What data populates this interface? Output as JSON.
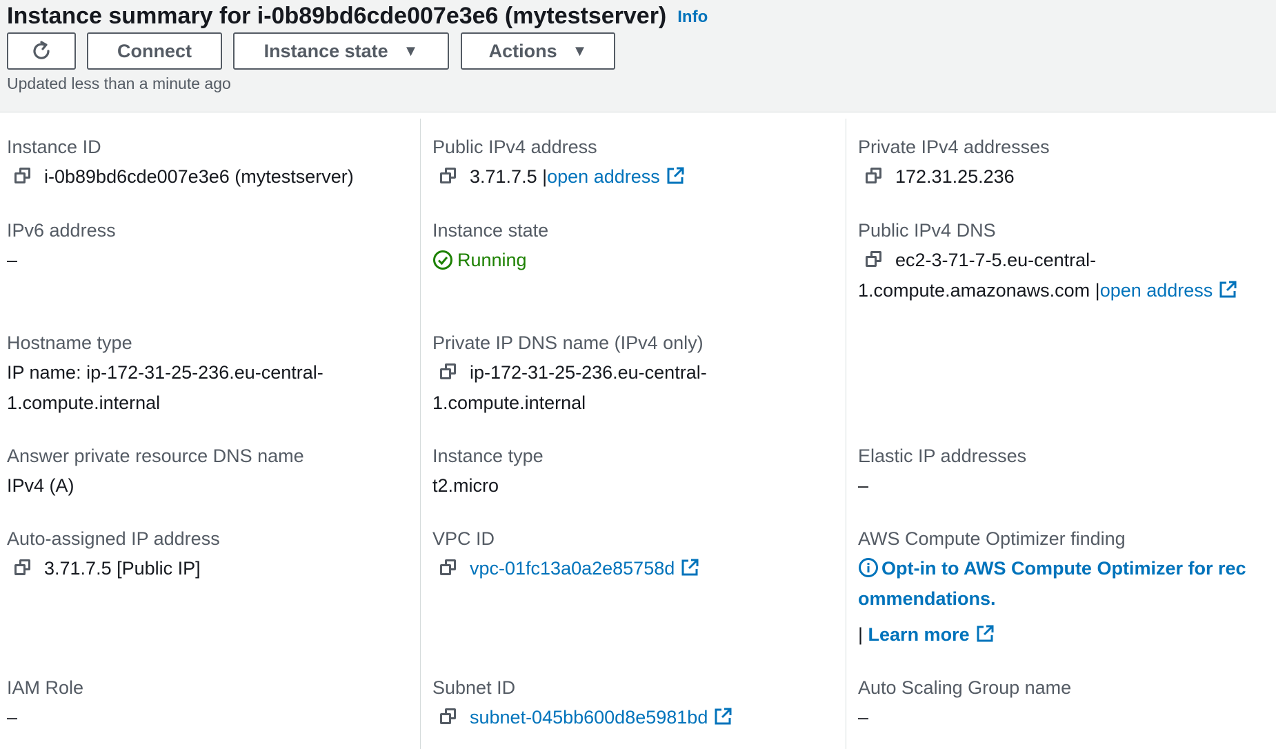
{
  "header": {
    "title": "Instance summary for i-0b89bd6cde007e3e6 (mytestserver)",
    "info_label": "Info",
    "buttons": {
      "refresh_icon": "refresh-icon",
      "connect": "Connect",
      "instance_state": "Instance state",
      "actions": "Actions"
    },
    "updated": "Updated less than a minute ago"
  },
  "details": {
    "instance_id": {
      "label": "Instance ID",
      "value": "i-0b89bd6cde007e3e6 (mytestserver)"
    },
    "public_ipv4": {
      "label": "Public IPv4 address",
      "value": "3.71.7.5",
      "sep": "|",
      "link": "open address"
    },
    "private_ipv4": {
      "label": "Private IPv4 addresses",
      "value": "172.31.25.236"
    },
    "ipv6": {
      "label": "IPv6 address",
      "value": "–"
    },
    "instance_state": {
      "label": "Instance state",
      "value": "Running"
    },
    "public_dns": {
      "label": "Public IPv4 DNS",
      "value_line1": "ec2-3-71-7-5.eu-central-",
      "value_line2": "1.compute.amazonaws.com",
      "sep": "|",
      "link": "open address"
    },
    "hostname_type": {
      "label": "Hostname type",
      "value_line1": "IP name: ip-172-31-25-236.eu-central-",
      "value_line2": "1.compute.internal"
    },
    "private_dns": {
      "label": "Private IP DNS name (IPv4 only)",
      "value_line1": "ip-172-31-25-236.eu-central-",
      "value_line2": "1.compute.internal"
    },
    "answer_dns": {
      "label": "Answer private resource DNS name",
      "value": "IPv4 (A)"
    },
    "instance_type": {
      "label": "Instance type",
      "value": "t2.micro"
    },
    "elastic_ip": {
      "label": "Elastic IP addresses",
      "value": "–"
    },
    "auto_ip": {
      "label": "Auto-assigned IP address",
      "value": "3.71.7.5 [Public IP]"
    },
    "vpc_id": {
      "label": "VPC ID",
      "value": "vpc-01fc13a0a2e85758d"
    },
    "optimizer": {
      "label": "AWS Compute Optimizer finding",
      "line1": "Opt-in to AWS Compute Optimizer for rec",
      "line2": "ommendations.",
      "sep": "|",
      "learn_more": "Learn more"
    },
    "iam_role": {
      "label": "IAM Role",
      "value": "–"
    },
    "subnet_id": {
      "label": "Subnet ID",
      "value": "subnet-045bb600d8e5981bd"
    },
    "asg_name": {
      "label": "Auto Scaling Group name",
      "value": "–"
    }
  },
  "colors": {
    "link": "#0073bb",
    "success": "#1d8102",
    "text": "#16191f",
    "label": "#545b64",
    "header_bg": "#f2f3f3"
  }
}
